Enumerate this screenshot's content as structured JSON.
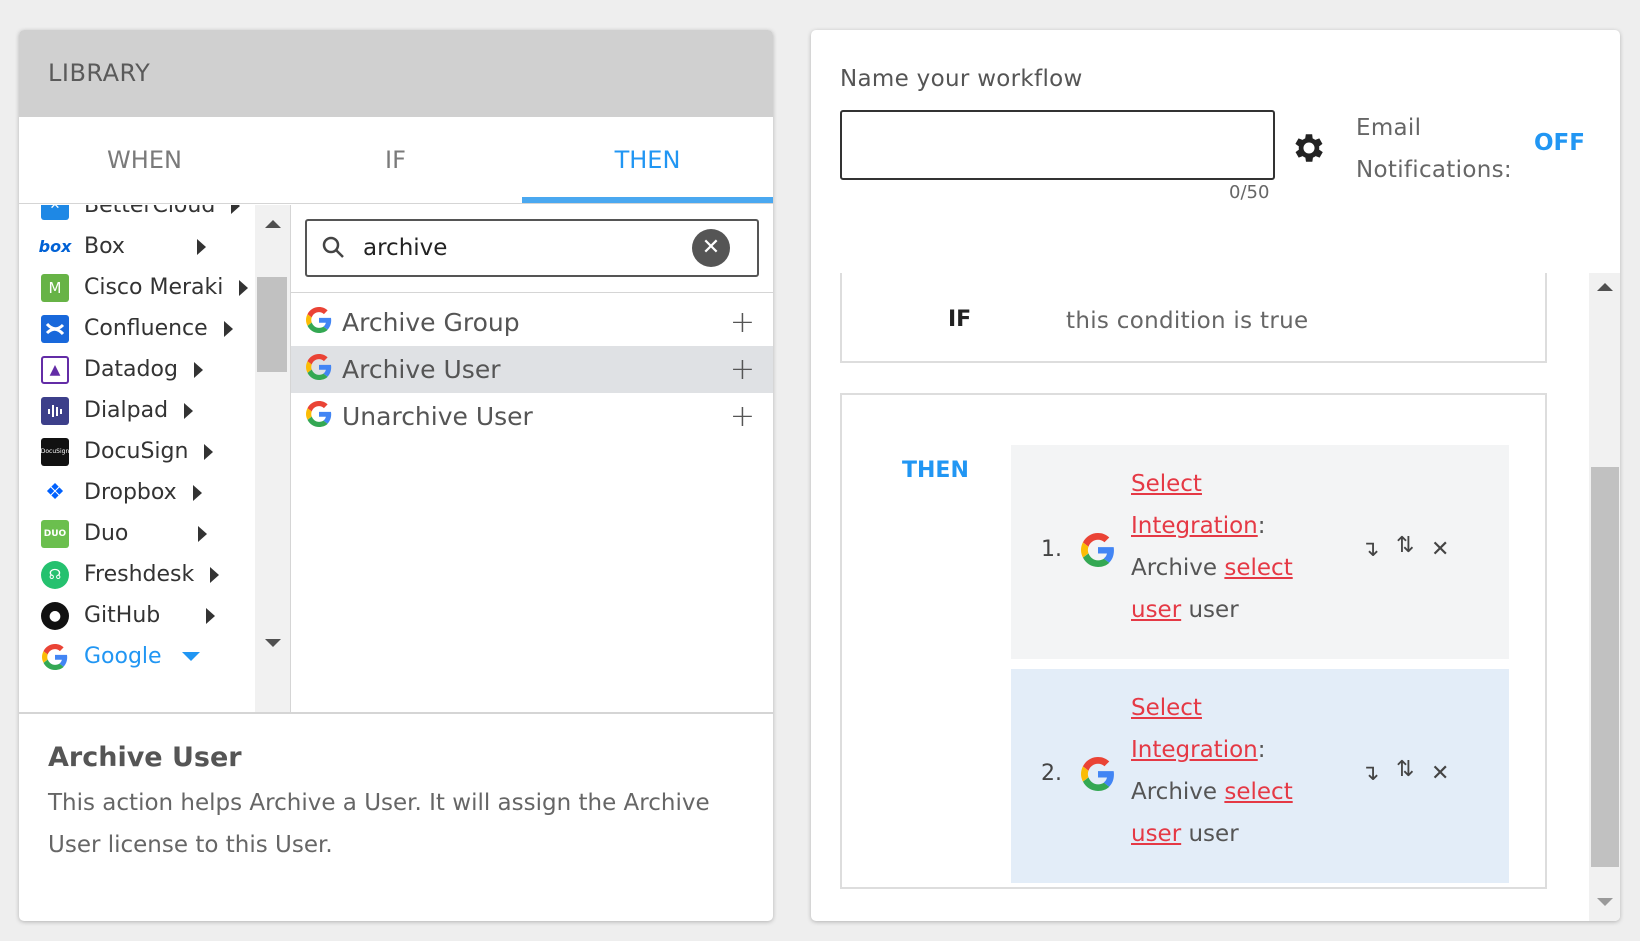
{
  "library": {
    "title": "LIBRARY",
    "tabs": [
      "WHEN",
      "IF",
      "THEN"
    ],
    "active_tab": "THEN",
    "nav_items": [
      {
        "label": "BetterCloud",
        "icon": "bettercloud-icon",
        "color": "#1e88e5"
      },
      {
        "label": "Box",
        "icon": "box-icon",
        "color": "#0061d5"
      },
      {
        "label": "Cisco Meraki",
        "icon": "meraki-icon",
        "color": "#67b346"
      },
      {
        "label": "Confluence",
        "icon": "confluence-icon",
        "color": "#1868db"
      },
      {
        "label": "Datadog",
        "icon": "datadog-icon",
        "color": "#632ca6"
      },
      {
        "label": "Dialpad",
        "icon": "dialpad-icon",
        "color": "#3c3f8a"
      },
      {
        "label": "DocuSign",
        "icon": "docusign-icon",
        "color": "#111111"
      },
      {
        "label": "Dropbox",
        "icon": "dropbox-icon",
        "color": "#0061fe"
      },
      {
        "label": "Duo",
        "icon": "duo-icon",
        "color": "#6bbf4e"
      },
      {
        "label": "Freshdesk",
        "icon": "freshdesk-icon",
        "color": "#25c16f"
      },
      {
        "label": "GitHub",
        "icon": "github-icon",
        "color": "#111111"
      },
      {
        "label": "Google",
        "icon": "google-icon",
        "color": "#4285f4"
      }
    ],
    "search": {
      "value": "archive",
      "placeholder": "Search"
    },
    "results": [
      {
        "label": "Archive Group"
      },
      {
        "label": "Archive User"
      },
      {
        "label": "Unarchive User"
      }
    ],
    "description": {
      "title": "Archive User",
      "text": "This action helps Archive a User. It will assign the Archive User license to this User."
    }
  },
  "workflow": {
    "name_label": "Name your workflow",
    "name_value": "",
    "char_count": "0/50",
    "email_label_1": "Email",
    "email_label_2": "Notifications:",
    "email_toggle": "OFF",
    "if_label": "IF",
    "if_text": "this condition is true",
    "then_label": "THEN",
    "steps": [
      {
        "num": "1.",
        "integration_link": "Select Integration",
        "colon": ":",
        "verb": "Archive",
        "select_link": "select user",
        "suffix": "user"
      },
      {
        "num": "2.",
        "integration_link": "Select Integration",
        "colon": ":",
        "verb": "Archive",
        "select_link": "select user",
        "suffix": "user"
      }
    ]
  },
  "colors": {
    "accent": "#2196f3",
    "link_red": "#e53945",
    "selected_row": "#dfe1e4",
    "step_active_bg": "#e3edf8"
  }
}
